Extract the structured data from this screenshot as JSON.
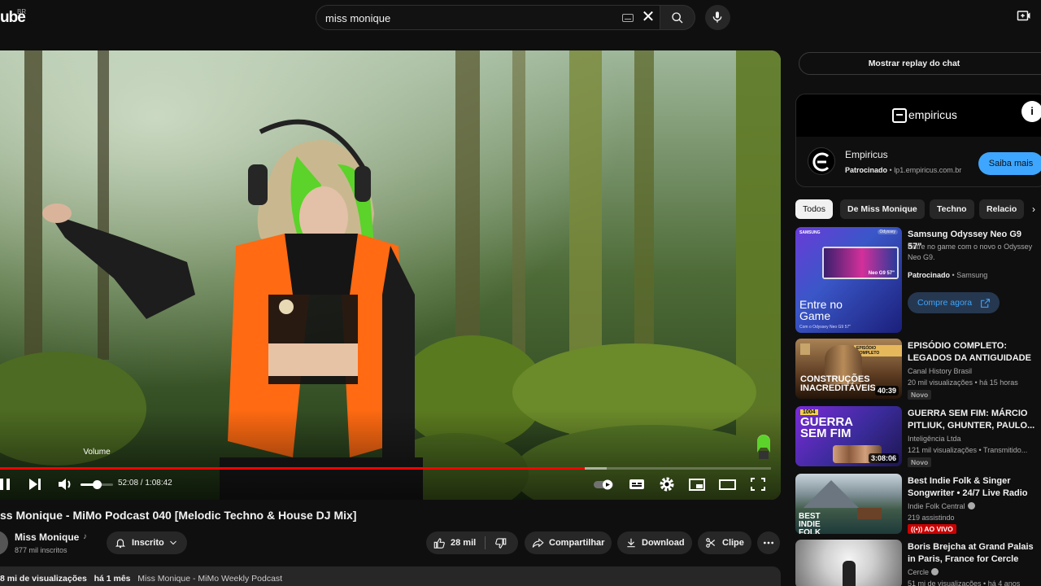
{
  "header": {
    "logo_text": "ube",
    "country_code": "BR",
    "search_value": "miss monique",
    "clear_glyph": "✕"
  },
  "player": {
    "volume_tooltip": "Volume",
    "time_display": "52:08 / 1:08:42",
    "progress_played": 0.758,
    "progress_buffered": 0.787,
    "volume_level": 0.5
  },
  "video": {
    "title": "ss Monique - MiMo Podcast 040 [Melodic Techno & House DJ Mix]",
    "channel_name": "Miss Monique",
    "channel_note": "♪",
    "subscribers": "877 mil inscritos",
    "subscribe_label": "Inscrito",
    "likes": "28 mil",
    "share_label": "Compartilhar",
    "download_label": "Download",
    "clip_label": "Clipe",
    "views": "8 mi de visualizações",
    "age": "há 1 mês",
    "playlist": "Miss Monique - MiMo Weekly Podcast"
  },
  "sidebar": {
    "chat_replay_label": "Mostrar replay do chat",
    "ad": {
      "brand_banner": "empiricus",
      "info_glyph": "i",
      "name": "Empiricus",
      "sponsored": "Patrocinado",
      "domain": "lp1.empiricus.com.br",
      "cta": "Saiba mais"
    },
    "chips": [
      "Todos",
      "De Miss Monique",
      "Techno",
      "Relacio"
    ],
    "chip_next_glyph": "›",
    "promo": {
      "title": "Samsung Odyssey Neo G9 57\"",
      "description": "Entre no game com o novo o Odyssey Neo G9.",
      "sponsored": "Patrocinado",
      "advertiser": "Samsung",
      "cta": "Compre agora",
      "thumb_text": "Entre no Game",
      "thumb_sub": "Com o Odyssey Neo G9 57\"",
      "thumb_brand": "SAMSUNG",
      "thumb_badge": "Odyssey",
      "thumb_screen_text": "Neo G9 57\""
    },
    "recommendations": [
      {
        "title": "EPISÓDIO COMPLETO: LEGADOS DA ANTIGUIDADE -...",
        "channel": "Canal History Brasil",
        "meta": "20 mil visualizações  •  há 15 horas",
        "badge": "Novo",
        "duration": "40:39",
        "thumb_text": "CONSTRUÇÕES INACREDITÁVEIS",
        "thumb_tag": "EPISÓDIO COMPLETO"
      },
      {
        "title": "GUERRA SEM FIM: MÁRCIO PITLIUK, GHUNTER, PAULO...",
        "channel": "Inteligência Ltda",
        "meta": "121 mil visualizações  •  Transmitido...",
        "badge": "Novo",
        "duration": "3:08:06",
        "thumb_text": "GUERRA SEM FIM",
        "thumb_tag": "1004"
      },
      {
        "title": "Best Indie Folk & Singer Songwriter • 24/7 Live Radio •...",
        "channel": "Indie Folk Central",
        "meta": "219 assistindo",
        "badge": "AO VIVO",
        "thumb_text": "BEST INDIE FOLK"
      },
      {
        "title": "Boris Brejcha at Grand Palais in Paris, France for Cercle",
        "channel": "Cercle",
        "meta": "51 mi de visualizações  •  há 4 anos"
      }
    ]
  }
}
